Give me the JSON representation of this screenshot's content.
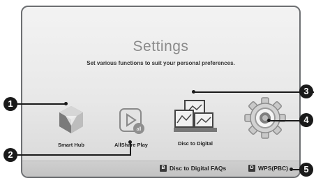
{
  "screen": {
    "title": "Settings",
    "subtitle": "Set various functions to suit your personal preferences."
  },
  "items": [
    {
      "label": "Smart Hub",
      "icon": "smart-hub-icon"
    },
    {
      "label": "AllShare Play",
      "icon": "allshare-play-icon"
    },
    {
      "label": "Disc to Digital",
      "icon": "disc-to-digital-icon"
    },
    {
      "label": "",
      "icon": "settings-gear-icon"
    }
  ],
  "bottom_bar": {
    "faq": {
      "key": "B",
      "label": "Disc to Digital FAQs"
    },
    "wps": {
      "key": "D",
      "label": "WPS(PBC)"
    }
  },
  "callouts": [
    "1",
    "2",
    "3",
    "4",
    "5"
  ]
}
